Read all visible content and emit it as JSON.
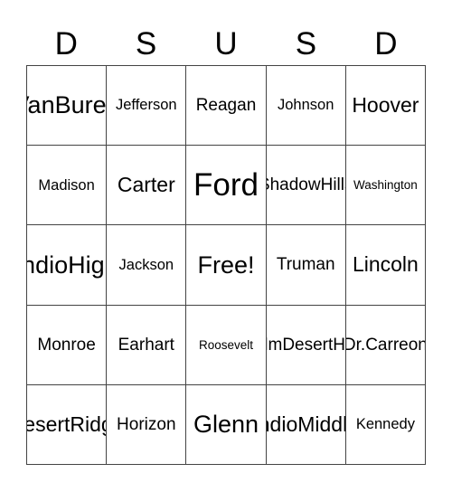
{
  "title_letters": [
    "D",
    "S",
    "U",
    "S",
    "D"
  ],
  "cells": [
    {
      "text": "Van\nBuren",
      "size": "xl"
    },
    {
      "text": "Jefferson",
      "size": "sm"
    },
    {
      "text": "Reagan",
      "size": "md"
    },
    {
      "text": "Johnson",
      "size": "sm"
    },
    {
      "text": "Hoover",
      "size": "lg"
    },
    {
      "text": "Madison",
      "size": "sm"
    },
    {
      "text": "Carter",
      "size": "lg"
    },
    {
      "text": "Ford",
      "size": "xxl"
    },
    {
      "text": "Shadow\nHills",
      "size": "md"
    },
    {
      "text": "Washington",
      "size": "xs"
    },
    {
      "text": "Indio\nHigh",
      "size": "xl"
    },
    {
      "text": "Jackson",
      "size": "sm"
    },
    {
      "text": "Free!",
      "size": "xl"
    },
    {
      "text": "Truman",
      "size": "md"
    },
    {
      "text": "Lincoln",
      "size": "lg"
    },
    {
      "text": "Monroe",
      "size": "md"
    },
    {
      "text": "Earhart",
      "size": "md"
    },
    {
      "text": "Roosevelt",
      "size": "xs"
    },
    {
      "text": "Palm\nDesert\nHigh",
      "size": "md"
    },
    {
      "text": "Dr.\nCarreon",
      "size": "md"
    },
    {
      "text": "Desert\nRidge",
      "size": "lg"
    },
    {
      "text": "Horizon",
      "size": "md"
    },
    {
      "text": "Glenn",
      "size": "xl"
    },
    {
      "text": "Indio\nMiddle",
      "size": "lg"
    },
    {
      "text": "Kennedy",
      "size": "sm"
    }
  ]
}
